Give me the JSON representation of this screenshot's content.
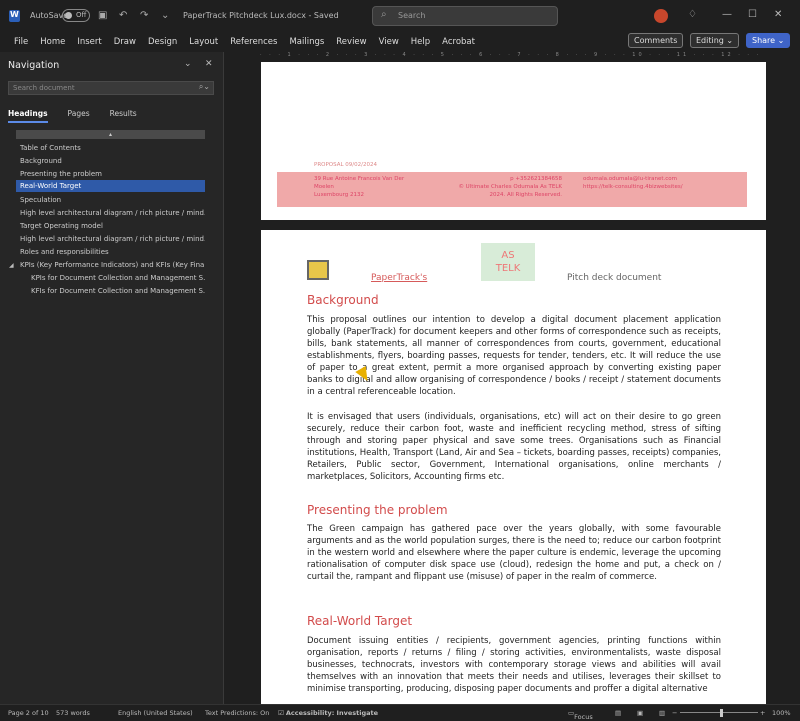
{
  "titlebar": {
    "autosave_label": "AutoSave",
    "autosave_state": "Off",
    "document_title": "PaperTrack Pitchdeck Lux.docx - Saved",
    "search_placeholder": "Search",
    "icons": [
      "word-app-icon",
      "save-icon",
      "undo-icon",
      "redo-icon",
      "customize-icon",
      "avatar",
      "lightbulb-icon",
      "minimize-icon",
      "maximize-icon",
      "close-icon"
    ]
  },
  "menu": {
    "items": [
      "File",
      "Home",
      "Insert",
      "Draw",
      "Design",
      "Layout",
      "References",
      "Mailings",
      "Review",
      "View",
      "Help",
      "Acrobat"
    ],
    "comments_label": "Comments",
    "editing_label": "Editing",
    "share_label": "Share"
  },
  "nav": {
    "title": "Navigation",
    "search_placeholder": "Search document",
    "tabs": [
      "Headings",
      "Pages",
      "Results"
    ],
    "headings": [
      {
        "label": "Table of Contents",
        "level": 1
      },
      {
        "label": "Background",
        "level": 1
      },
      {
        "label": "Presenting the problem",
        "level": 1
      },
      {
        "label": "Real-World Target",
        "level": 1,
        "selected": true
      },
      {
        "label": "Speculation",
        "level": 1
      },
      {
        "label": "High level architectural diagram / rich picture / mind...",
        "level": 1
      },
      {
        "label": "Target Operating model",
        "level": 1
      },
      {
        "label": "High level architectural diagram / rich picture / mind...",
        "level": 1
      },
      {
        "label": "Roles and responsibilities",
        "level": 1
      },
      {
        "label": "KPIs (Key Performance Indicators) and KFIs (Key Fina...",
        "level": 1,
        "expanded": true
      },
      {
        "label": "KPIs for Document Collection and Management S...",
        "level": 2
      },
      {
        "label": "KFIs for Document Collection and Management S...",
        "level": 2
      }
    ]
  },
  "ruler_text": "· · · 1 · · · 2 · · · 3 · · · 4 · · · 5 · · · 6 · · · 7 · · · 8 · · · 9 · · · 10 · · · 11 · · · 12 · · · 13 · · · 14 · · · 15 · · · 16 · · · 17 · · · 18 ·",
  "page1": {
    "meta": "PROPOSAL   09/02/2024",
    "footer": {
      "col1": "39 Rue Antoine Francois Van Der\nMoelen\nLuxembourg 2132",
      "col2": "p +352621384658\n© Ultimate Charles Odumala As TELK\n2024. All Rights Reserved.",
      "col3": "odumala.odumala@lu-tiranet.com\nhttps://telk-consulting.4bizwebsites/"
    }
  },
  "page2": {
    "brand": "PaperTrack's",
    "logo_box": "AS\nTELK",
    "doc_type": "Pitch deck document",
    "sections": [
      {
        "heading": "Background",
        "paragraphs": [
          "This proposal outlines our intention to develop a digital document placement application globally (PaperTrack) for document keepers and other forms of correspondence such as receipts, bills, bank statements, all manner of correspondences from courts, government, educational establishments, flyers, boarding passes, requests for tender, tenders, etc. It will reduce the use of paper to a great extent, permit a more organised approach by converting existing paper banks to digital and allow organising of correspondence / books / receipt / statement documents in a central referenceable location.",
          "It is envisaged that users (individuals, organisations, etc) will act on their desire to go green securely, reduce their carbon foot, waste and inefficient recycling method, stress of sifting through and storing paper physical and save some trees. Organisations such as Financial institutions, Health, Transport (Land, Air and Sea – tickets, boarding passes, receipts) companies, Retailers, Public sector, Government, International organisations, online merchants / marketplaces, Solicitors, Accounting firms etc."
        ]
      },
      {
        "heading": "Presenting the problem",
        "paragraphs": [
          "The Green campaign has gathered pace over the years globally, with some favourable arguments and as the world population surges, there is the need to; reduce our carbon footprint in the western world and elsewhere where the paper culture is endemic, leverage the upcoming rationalisation of computer disk space use (cloud), redesign the home and put, a check on / curtail the, rampant and flippant use (misuse) of paper in the realm of commerce."
        ]
      },
      {
        "heading": "Real-World Target",
        "paragraphs": [
          "Document issuing entities / recipients, government agencies, printing functions within organisation, reports / returns / filing / storing activities, environmentalists, waste disposal businesses, technocrats, investors with contemporary storage views and abilities will avail themselves with an innovation that meets their needs and utilises, leverages their skillset to minimise transporting, producing, disposing paper documents and proffer a digital alternative"
        ]
      }
    ]
  },
  "status": {
    "page": "Page 2 of 10",
    "words": "573 words",
    "language": "English (United States)",
    "predictions": "Text Predictions: On",
    "accessibility": "Accessibility: Investigate",
    "focus": "Focus",
    "zoom": "100%"
  }
}
